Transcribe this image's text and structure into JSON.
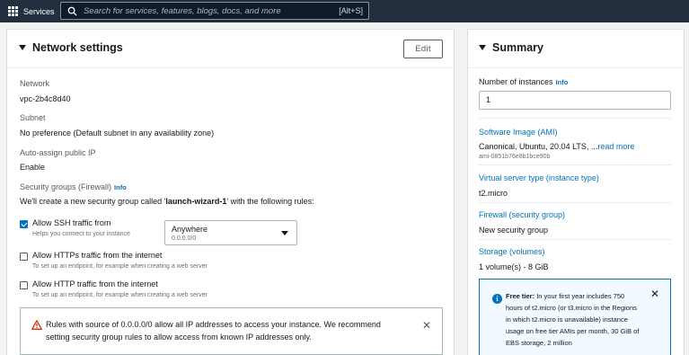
{
  "topnav": {
    "services_label": "Services",
    "search_placeholder": "Search for services, features, blogs, docs, and more",
    "search_shortcut": "[Alt+S]"
  },
  "network": {
    "title": "Network settings",
    "edit_label": "Edit",
    "network_label": "Network",
    "network_value": "vpc-2b4c8d40",
    "subnet_label": "Subnet",
    "subnet_value": "No preference (Default subnet in any availability zone)",
    "public_ip_label": "Auto-assign public IP",
    "public_ip_value": "Enable",
    "sg_label": "Security groups (Firewall)",
    "info_label": "Info",
    "sg_desc_prefix": "We'll create a new security group called '",
    "sg_name": "launch-wizard-1",
    "sg_desc_suffix": "' with the following rules:",
    "rules": [
      {
        "label": "Allow SSH traffic from",
        "desc": "Helps you connect to your instance",
        "checked": true
      },
      {
        "label": "Allow HTTPs traffic from the internet",
        "desc": "To set up an endpoint, for example when creating a web server",
        "checked": false
      },
      {
        "label": "Allow HTTP traffic from the internet",
        "desc": "To set up an endpoint, for example when creating a web server",
        "checked": false
      }
    ],
    "ssh_source": {
      "value": "Anywhere",
      "sub": "0.0.0.0/0"
    },
    "warning_text": "Rules with source of 0.0.0.0/0 allow all IP addresses to access your instance. We recommend setting security group rules to allow access from known IP addresses only."
  },
  "summary": {
    "title": "Summary",
    "instances_label": "Number of instances",
    "info_label": "Info",
    "instances_value": "1",
    "ami_label": "Software Image (AMI)",
    "ami_value": "Canonical, Ubuntu, 20.04 LTS, ...",
    "ami_read_more": "read more",
    "ami_id": "ami-0851b76e8b1bce90b",
    "instance_type_label": "Virtual server type (instance type)",
    "instance_type_value": "t2.micro",
    "firewall_label": "Firewall (security group)",
    "firewall_value": "New security group",
    "storage_label": "Storage (volumes)",
    "storage_value": "1 volume(s) - 8 GiB",
    "free_tier_title": "Free tier:",
    "free_tier_text": "In your first year includes 750 hours of t2.micro (or t3.micro in the Regions in which t2.micro is unavailable) instance usage on free tier AMIs per month, 30 GiB of EBS storage, 2 million"
  },
  "colors": {
    "nav": "#232f3e",
    "link": "#0073bb",
    "warning": "#d13212"
  }
}
